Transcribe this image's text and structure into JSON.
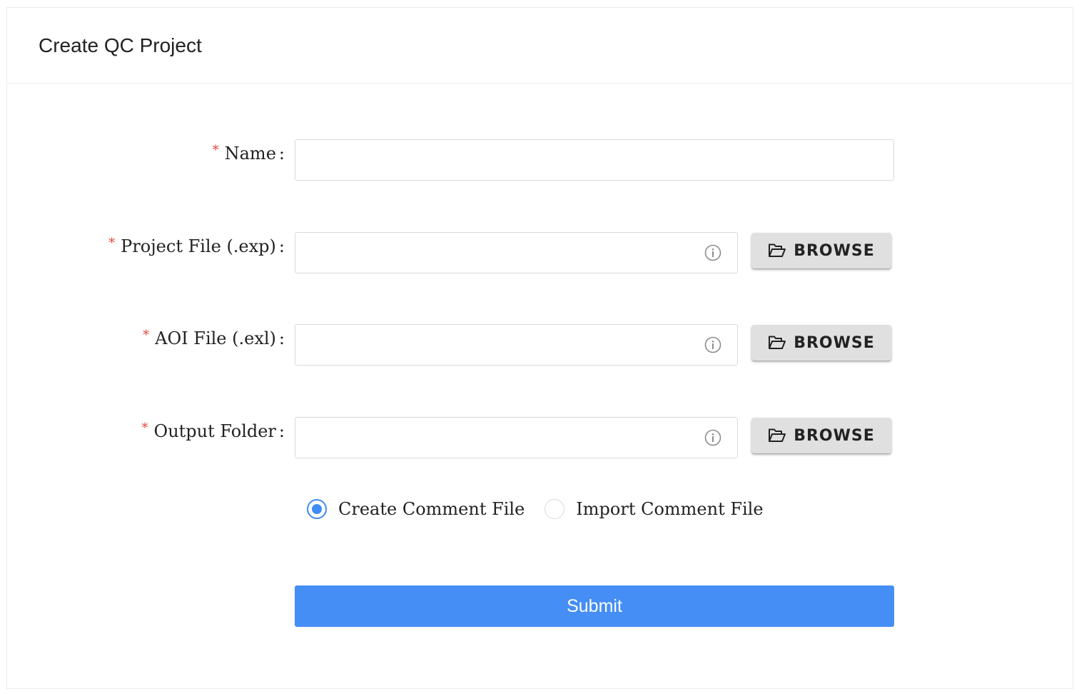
{
  "page": {
    "title": "Create QC Project"
  },
  "form": {
    "name": {
      "required": "*",
      "label": "Name",
      "colon": ":",
      "value": ""
    },
    "project_file": {
      "required": "*",
      "label": "Project File (.exp)",
      "colon": ":",
      "value": "",
      "info_icon": "info-circle-icon",
      "browse_icon": "folder-open-icon",
      "browse_label": "BROWSE"
    },
    "aoi_file": {
      "required": "*",
      "label": "AOI File (.exl)",
      "colon": ":",
      "value": "",
      "info_icon": "info-circle-icon",
      "browse_icon": "folder-open-icon",
      "browse_label": "BROWSE"
    },
    "output_folder": {
      "required": "*",
      "label": "Output Folder",
      "colon": ":",
      "value": "",
      "info_icon": "info-circle-icon",
      "browse_icon": "folder-open-icon",
      "browse_label": "BROWSE"
    },
    "comment_mode": {
      "options": [
        {
          "label": "Create Comment File",
          "checked": true
        },
        {
          "label": "Import Comment File",
          "checked": false
        }
      ]
    },
    "submit_label": "Submit"
  },
  "colors": {
    "accent": "#448ef5",
    "radio_checked": "#3f8cf7",
    "required_star": "#e0443a",
    "browse_button_bg": "#e0e0e0",
    "border": "#d9d9d9"
  }
}
